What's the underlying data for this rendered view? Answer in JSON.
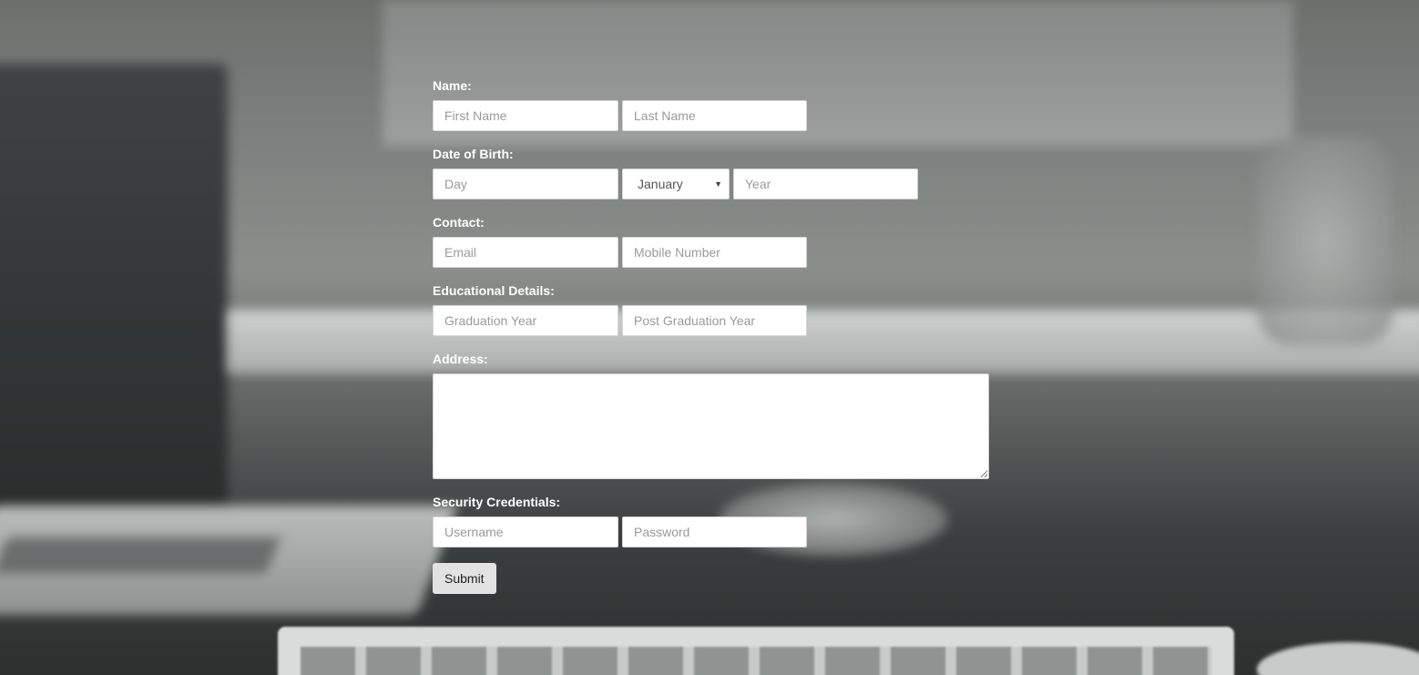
{
  "form": {
    "name": {
      "label": "Name:",
      "first_placeholder": "First Name",
      "last_placeholder": "Last Name"
    },
    "dob": {
      "label": "Date of Birth:",
      "day_placeholder": "Day",
      "month_selected": "January",
      "year_placeholder": "Year"
    },
    "contact": {
      "label": "Contact:",
      "email_placeholder": "Email",
      "mobile_placeholder": "Mobile Number"
    },
    "education": {
      "label": "Educational Details:",
      "grad_placeholder": "Graduation Year",
      "postgrad_placeholder": "Post Graduation Year"
    },
    "address": {
      "label": "Address:"
    },
    "security": {
      "label": "Security Credentials:",
      "username_placeholder": "Username",
      "password_placeholder": "Password"
    },
    "submit_label": "Submit"
  },
  "icons": {
    "select_caret": "chevron-down-icon"
  }
}
